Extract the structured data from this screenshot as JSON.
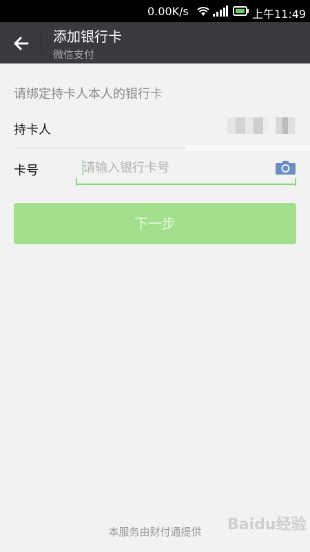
{
  "statusbar": {
    "speed": "0.00K/s",
    "time": "上午11:49"
  },
  "navbar": {
    "title": "添加银行卡",
    "subtitle": "微信支付"
  },
  "form": {
    "tip": "请绑定持卡人本人的银行卡",
    "holder_label": "持卡人",
    "card_label": "卡号",
    "card_placeholder": "请输入银行卡号",
    "card_value": ""
  },
  "next_button": "下一步",
  "footer": "本服务由财付通提供",
  "watermark": "Baidu经验",
  "colors": {
    "navbar": "#393a3f",
    "accent": "#8ed97a",
    "button_disabled": "#a3e08d"
  },
  "icons": [
    "back-arrow-icon",
    "camera-icon",
    "wifi-icon",
    "signal-icon",
    "battery-icon"
  ]
}
